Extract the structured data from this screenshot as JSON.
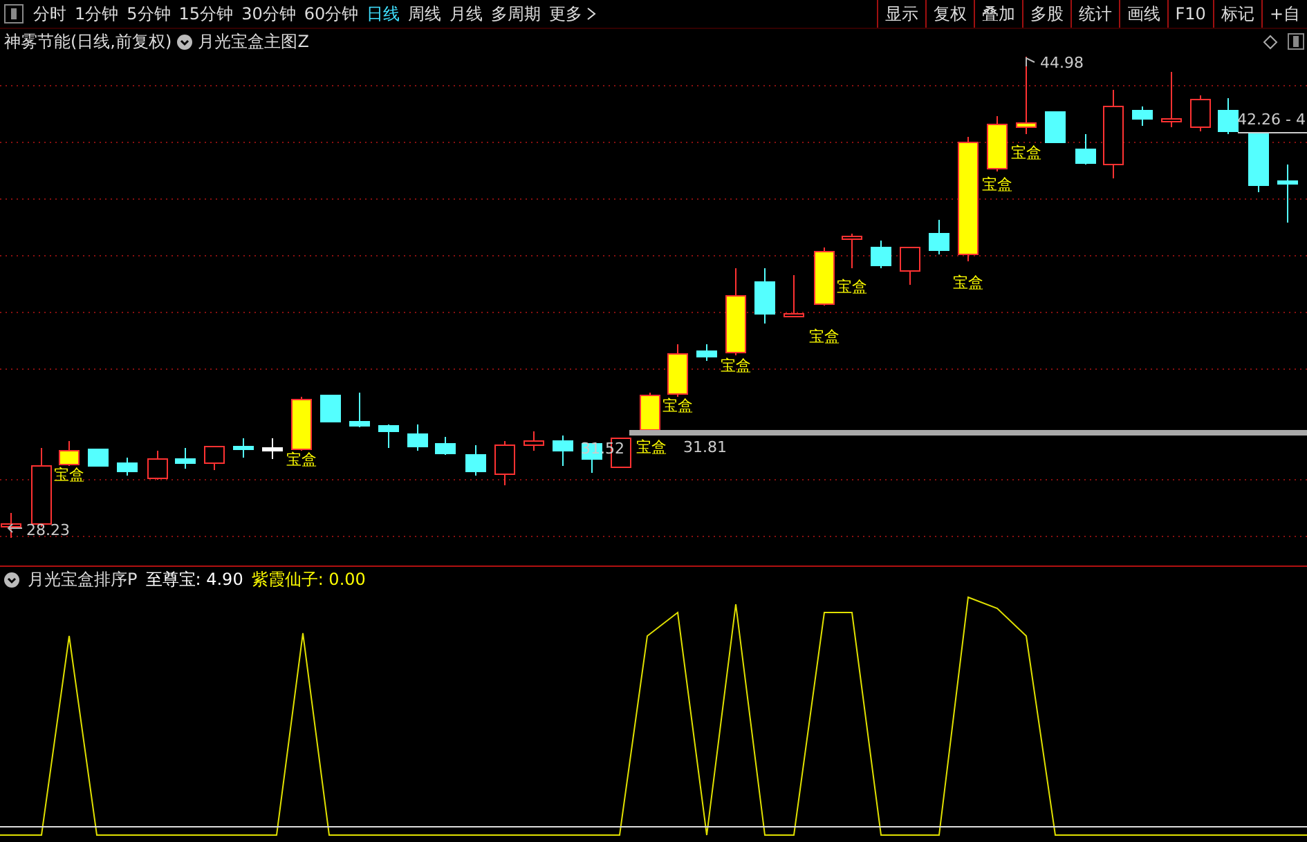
{
  "toolbar": {
    "periods": [
      {
        "label": "分时",
        "selected": false
      },
      {
        "label": "1分钟",
        "selected": false
      },
      {
        "label": "5分钟",
        "selected": false
      },
      {
        "label": "15分钟",
        "selected": false
      },
      {
        "label": "30分钟",
        "selected": false
      },
      {
        "label": "60分钟",
        "selected": false
      },
      {
        "label": "日线",
        "selected": true
      },
      {
        "label": "周线",
        "selected": false
      },
      {
        "label": "月线",
        "selected": false
      },
      {
        "label": "多周期",
        "selected": false
      },
      {
        "label": "更多",
        "selected": false
      }
    ],
    "tools": [
      "显示",
      "复权",
      "叠加",
      "多股",
      "统计",
      "画线",
      "F10",
      "标记",
      "+自"
    ]
  },
  "chart_header": {
    "title": "神雾节能(日线,前复权)",
    "indicator": "月光宝盒主图Z"
  },
  "main_chart": {
    "signal_labels": [
      "宝盒",
      "宝盒",
      "宝盒",
      "宝盒",
      "宝盒",
      "宝盒",
      "宝盒",
      "宝盒",
      "宝盒",
      "宝盒"
    ],
    "high_label": "44.98",
    "low_label": "28.23",
    "range_labels": [
      "31.52",
      "31.81"
    ],
    "current_range": "42.26 - 4"
  },
  "sub_chart": {
    "indicator": "月光宝盒排序P",
    "values": [
      {
        "name": "至尊宝:",
        "value": "4.90",
        "color": "#ffffff"
      },
      {
        "name": "紫霞仙子:",
        "value": "0.00",
        "color": "#ffff00"
      }
    ]
  }
}
